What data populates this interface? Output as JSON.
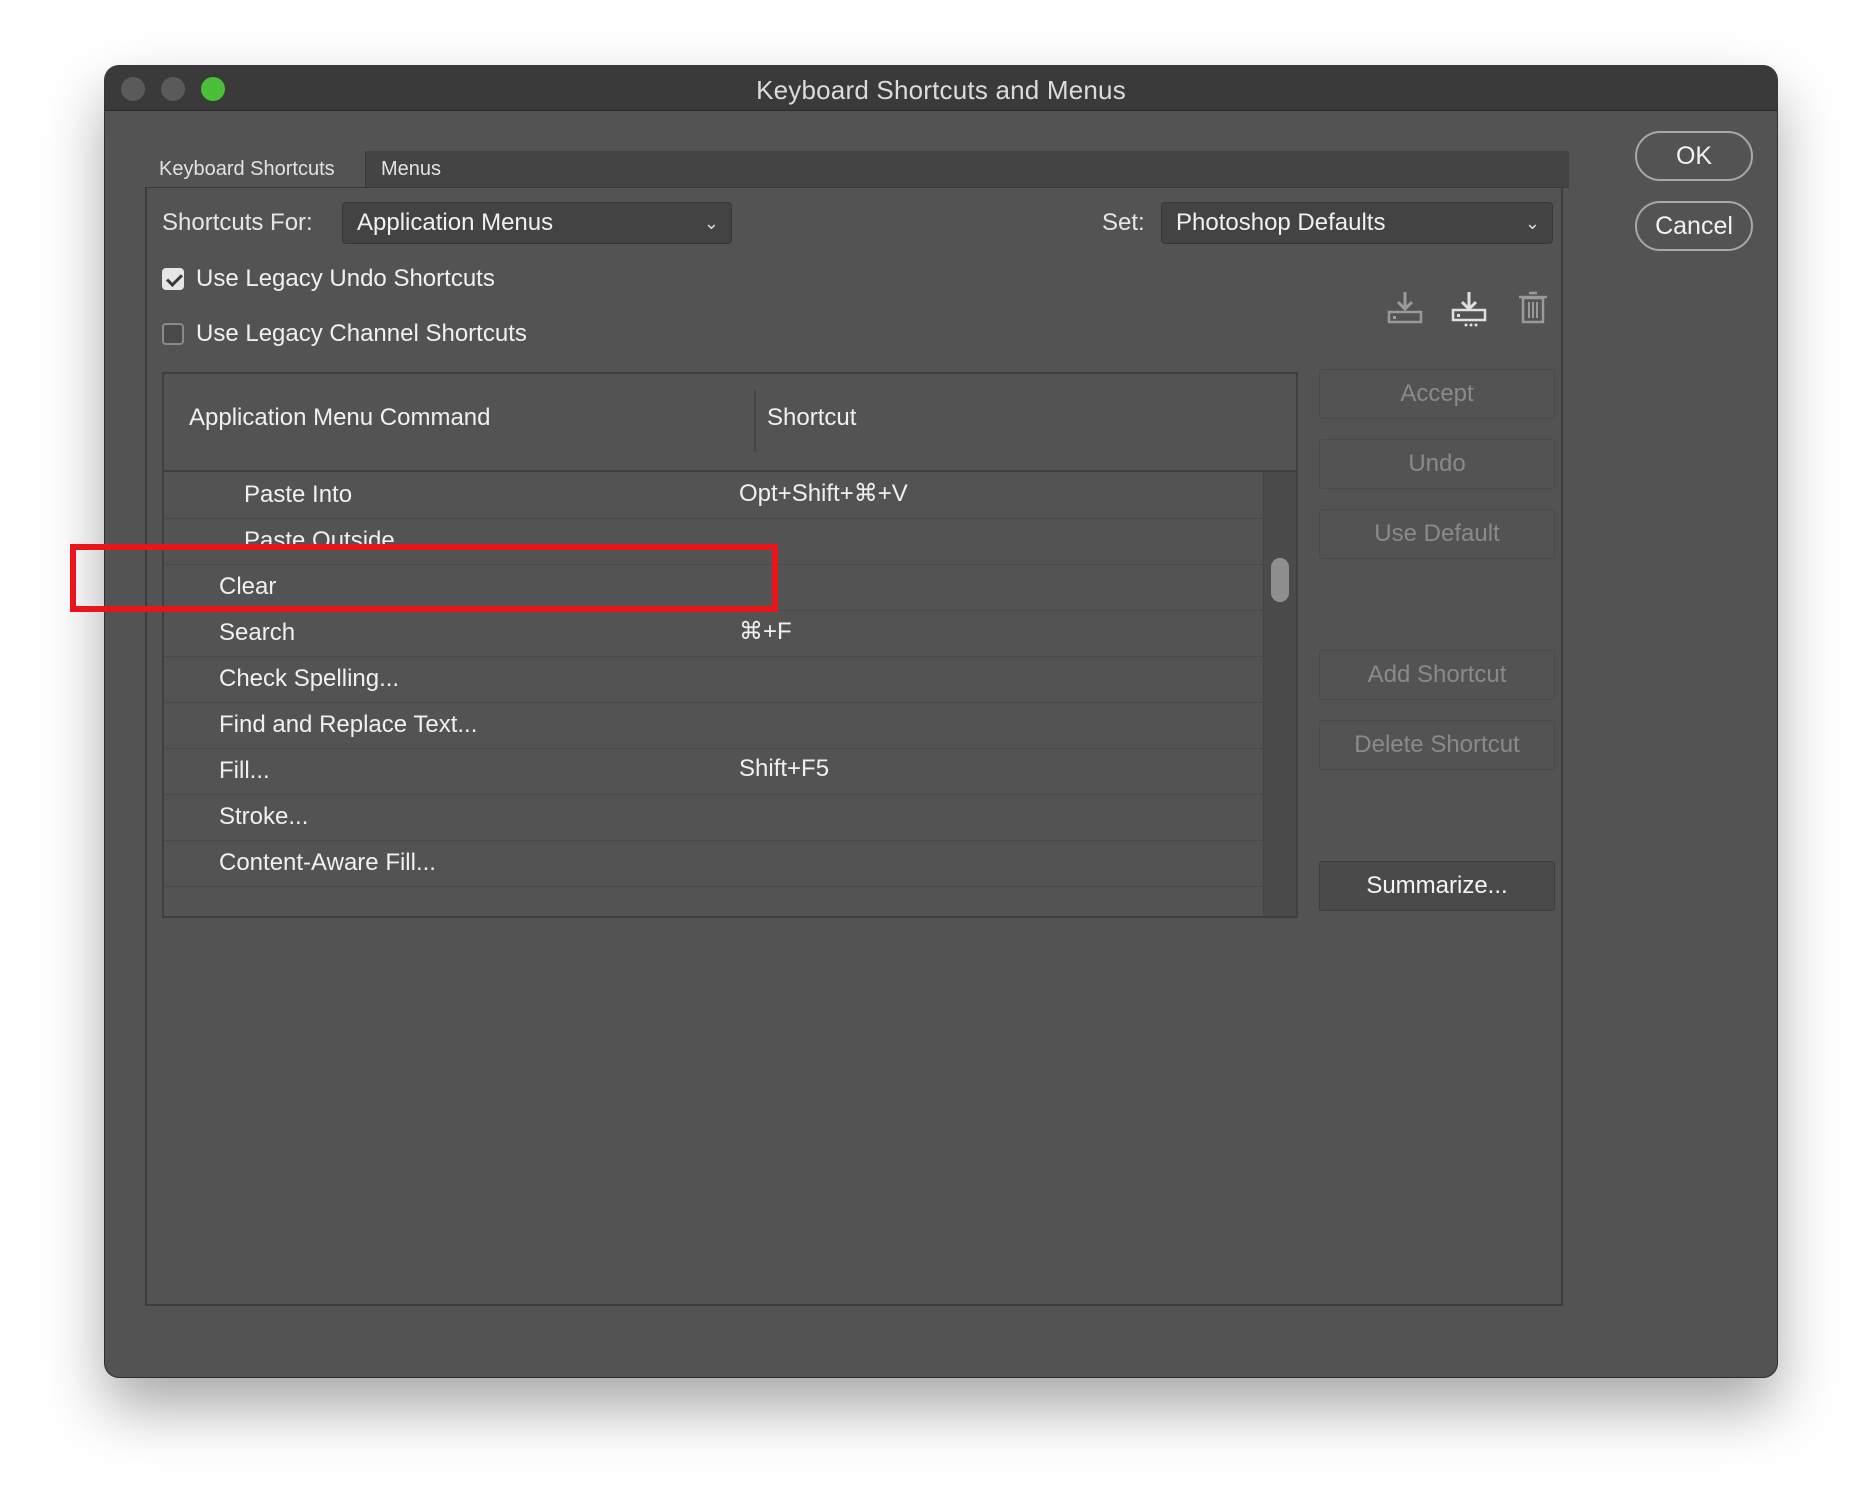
{
  "window": {
    "title": "Keyboard Shortcuts and Menus"
  },
  "tabs": [
    {
      "label": "Keyboard Shortcuts",
      "active": true
    },
    {
      "label": "Menus",
      "active": false
    }
  ],
  "shortcuts_for": {
    "label": "Shortcuts For:",
    "value": "Application Menus"
  },
  "set": {
    "label": "Set:",
    "value": "Photoshop Defaults"
  },
  "options": [
    {
      "label": "Use Legacy Undo Shortcuts",
      "checked": true
    },
    {
      "label": "Use Legacy Channel Shortcuts",
      "checked": false
    }
  ],
  "set_icons": [
    "save-set-icon",
    "save-set-as-icon",
    "delete-set-icon"
  ],
  "table": {
    "columns": [
      "Application Menu Command",
      "Shortcut"
    ],
    "rows": [
      {
        "command": "Paste Into",
        "shortcut": "Opt+Shift+⌘+V",
        "indent": 2
      },
      {
        "command": "Paste Outside",
        "shortcut": "",
        "indent": 2
      },
      {
        "command": "Clear",
        "shortcut": "",
        "indent": 1
      },
      {
        "command": "Search",
        "shortcut": "⌘+F",
        "indent": 1,
        "highlighted": true
      },
      {
        "command": "Check Spelling...",
        "shortcut": "",
        "indent": 1
      },
      {
        "command": "Find and Replace Text...",
        "shortcut": "",
        "indent": 1
      },
      {
        "command": "Fill...",
        "shortcut": "Shift+F5",
        "indent": 1
      },
      {
        "command": "Stroke...",
        "shortcut": "",
        "indent": 1
      },
      {
        "command": "Content-Aware Fill...",
        "shortcut": "",
        "indent": 1
      }
    ]
  },
  "side_buttons": {
    "accept": "Accept",
    "undo": "Undo",
    "use_default": "Use Default",
    "add_shortcut": "Add Shortcut",
    "delete_shortcut": "Delete Shortcut",
    "summarize": "Summarize..."
  },
  "dialog_buttons": {
    "ok": "OK",
    "cancel": "Cancel"
  },
  "colors": {
    "highlight": "#e8151b",
    "window_bg": "#535353",
    "zoom_button": "#4cbf3a"
  }
}
